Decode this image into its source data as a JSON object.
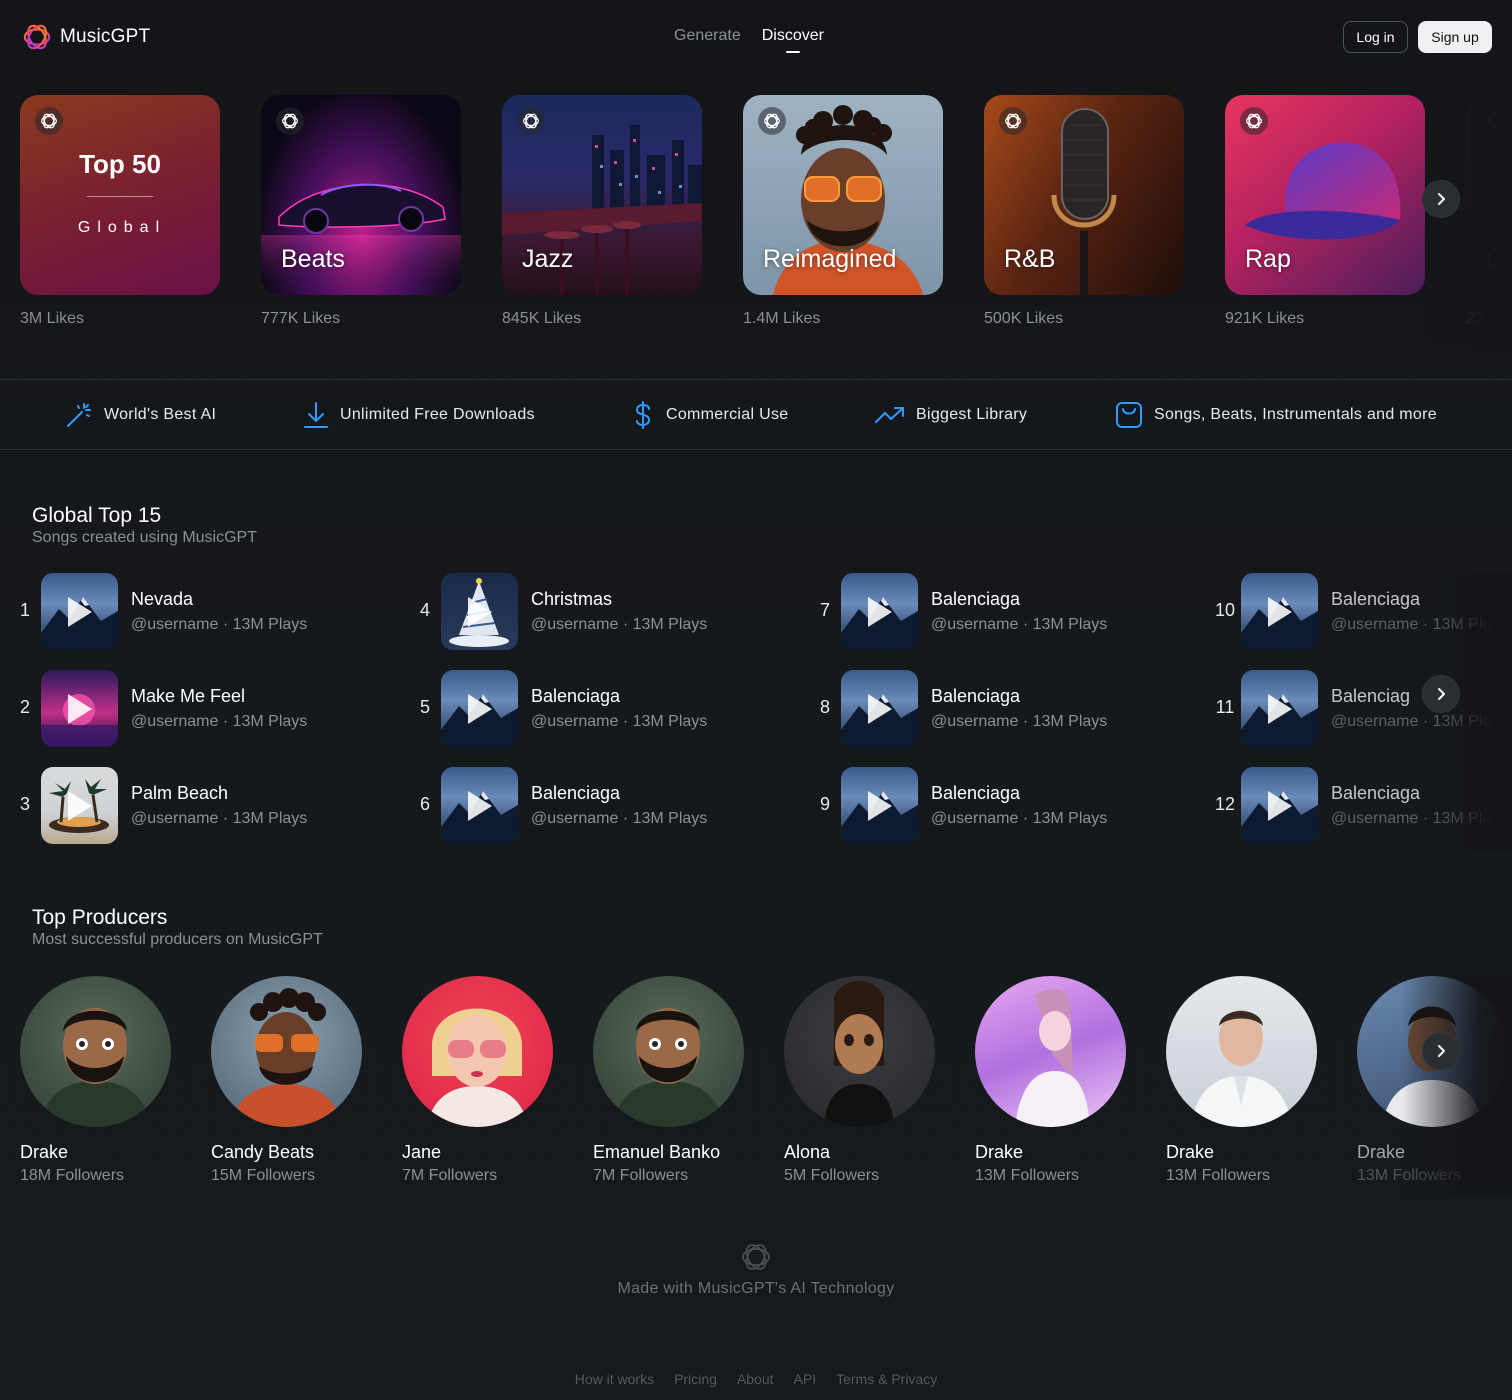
{
  "header": {
    "brand": "MusicGPT",
    "nav": [
      {
        "label": "Generate"
      },
      {
        "label": "Discover"
      }
    ],
    "login_label": "Log in",
    "signup_label": "Sign up"
  },
  "playlists": [
    {
      "title": "Top 50",
      "subtitle": "Global",
      "likes": "3M Likes"
    },
    {
      "title": "Beats",
      "likes": "777K Likes"
    },
    {
      "title": "Jazz",
      "likes": "845K Likes"
    },
    {
      "title": "Reimagined",
      "likes": "1.4M Likes"
    },
    {
      "title": "R&B",
      "likes": "500K Likes"
    },
    {
      "title": "Rap",
      "likes": "921K Likes"
    },
    {
      "title": "Cl",
      "likes": "234K"
    }
  ],
  "features": [
    {
      "label": "World's Best AI",
      "icon": "magic-wand-icon"
    },
    {
      "label": "Unlimited Free Downloads",
      "icon": "download-icon"
    },
    {
      "label": "Commercial Use",
      "icon": "dollar-icon"
    },
    {
      "label": "Biggest Library",
      "icon": "trending-up-icon"
    },
    {
      "label": "Songs, Beats, Instrumentals and more",
      "icon": "shopping-bag-icon"
    }
  ],
  "top_songs": {
    "title": "Global Top 15",
    "subtitle": "Songs created using MusicGPT",
    "items": [
      {
        "rank": "1",
        "title": "Nevada",
        "meta": "@username · 13M Plays"
      },
      {
        "rank": "2",
        "title": "Make Me Feel",
        "meta": "@username · 13M Plays"
      },
      {
        "rank": "3",
        "title": "Palm Beach",
        "meta": "@username · 13M Plays"
      },
      {
        "rank": "4",
        "title": "Christmas",
        "meta": "@username · 13M Plays"
      },
      {
        "rank": "5",
        "title": "Balenciaga",
        "meta": "@username · 13M Plays"
      },
      {
        "rank": "6",
        "title": "Balenciaga",
        "meta": "@username · 13M Plays"
      },
      {
        "rank": "7",
        "title": "Balenciaga",
        "meta": "@username · 13M Plays"
      },
      {
        "rank": "8",
        "title": "Balenciaga",
        "meta": "@username · 13M Plays"
      },
      {
        "rank": "9",
        "title": "Balenciaga",
        "meta": "@username · 13M Plays"
      },
      {
        "rank": "10",
        "title": "Balenciaga",
        "meta": "@username · 13M Pla"
      },
      {
        "rank": "11",
        "title": "Balenciag",
        "meta": "@username · 13M Pla"
      },
      {
        "rank": "12",
        "title": "Balenciaga",
        "meta": "@username · 13M Pla"
      }
    ]
  },
  "producers": {
    "title": "Top Producers",
    "subtitle": "Most successful producers on MusicGPT",
    "items": [
      {
        "name": "Drake",
        "followers": "18M Followers"
      },
      {
        "name": "Candy Beats",
        "followers": "15M Followers"
      },
      {
        "name": "Jane",
        "followers": "7M Followers"
      },
      {
        "name": "Emanuel Banko",
        "followers": "7M Followers"
      },
      {
        "name": "Alona",
        "followers": "5M Followers"
      },
      {
        "name": "Drake",
        "followers": "13M Followers"
      },
      {
        "name": "Drake",
        "followers": "13M Followers"
      },
      {
        "name": "Drake",
        "followers": "13M Followers"
      }
    ]
  },
  "footer": {
    "tagline": "Made with MusicGPT's AI Technology",
    "links": [
      "How it works",
      "Pricing",
      "About",
      "API",
      "Terms & Privacy"
    ]
  },
  "colors": {
    "background": "#141518",
    "muted_text": "#8c8f94",
    "accent_blue": "#2f9bff",
    "logo_gradient": [
      "#ff8a00",
      "#ff3d77",
      "#a23cff"
    ]
  }
}
